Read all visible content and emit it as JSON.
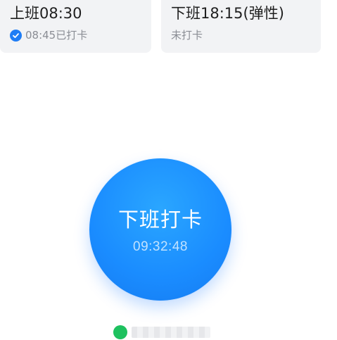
{
  "checkin": {
    "title": "上班08:30",
    "status": "08:45已打卡",
    "status_icon": "check-circle-icon"
  },
  "checkout": {
    "title": "下班18:15(弹性)",
    "status": "未打卡"
  },
  "punch_button": {
    "label": "下班打卡",
    "time": "09:32:48"
  },
  "location": {
    "icon": "location-status-icon",
    "text_redacted": true
  },
  "colors": {
    "accent": "#1a8cff",
    "check_icon": "#1f7df5",
    "location_icon": "#1ec15f",
    "card_bg": "#f2f3f5"
  }
}
